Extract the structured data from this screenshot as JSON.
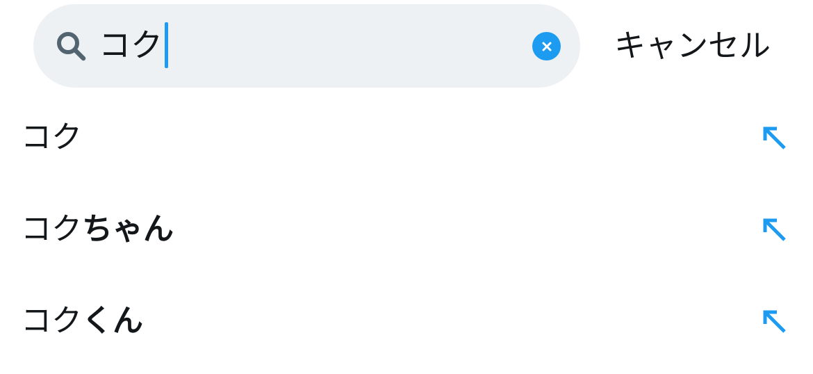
{
  "search": {
    "value": "コク",
    "cancel_label": "キャンセル"
  },
  "suggestions": [
    {
      "typed": "コク",
      "completion": ""
    },
    {
      "typed": "コク",
      "completion": "ちゃん"
    },
    {
      "typed": "コク",
      "completion": "くん"
    }
  ],
  "icons": {
    "search": "search-icon",
    "clear": "clear-icon",
    "fill_suggestion": "arrow-up-left-icon"
  },
  "colors": {
    "accent": "#1d9bf0",
    "search_bg": "#eef1f3",
    "icon_gray": "#536471",
    "text": "#14171a"
  }
}
